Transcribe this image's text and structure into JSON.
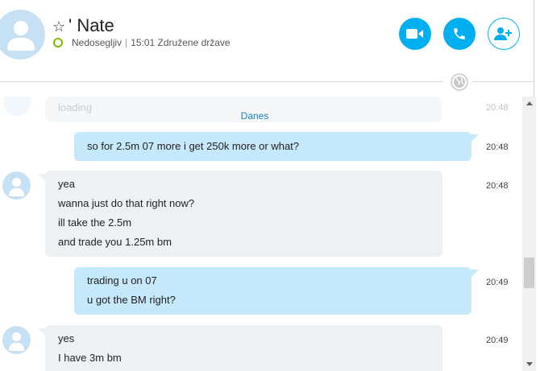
{
  "header": {
    "contact_name": "' Nate",
    "status": "Nedosegljiv",
    "local_time": "15:01 Združene države",
    "status_color": "#7fba00",
    "accent_color": "#00aff0",
    "icons": [
      "star-icon",
      "video-call-icon",
      "phone-call-icon",
      "add-contact-icon",
      "globe-icon"
    ]
  },
  "conversation": {
    "ghost_message": {
      "text": "loading",
      "time": "20:48"
    },
    "date_label": "Danes",
    "messages": [
      {
        "direction": "outgoing",
        "lines": [
          "so for 2.5m 07 more i get 250k more or what?"
        ],
        "time": "20:48"
      },
      {
        "direction": "incoming",
        "lines": [
          "yea",
          "wanna just do that right now?",
          "ill take the 2.5m",
          "and trade you 1.25m bm"
        ],
        "time": "20:48"
      },
      {
        "direction": "outgoing",
        "lines": [
          "trading u on 07",
          "u got the BM right?"
        ],
        "time": "20:49"
      },
      {
        "direction": "incoming",
        "lines": [
          "yes",
          "I have 3m bm"
        ],
        "time": "20:49"
      }
    ]
  }
}
